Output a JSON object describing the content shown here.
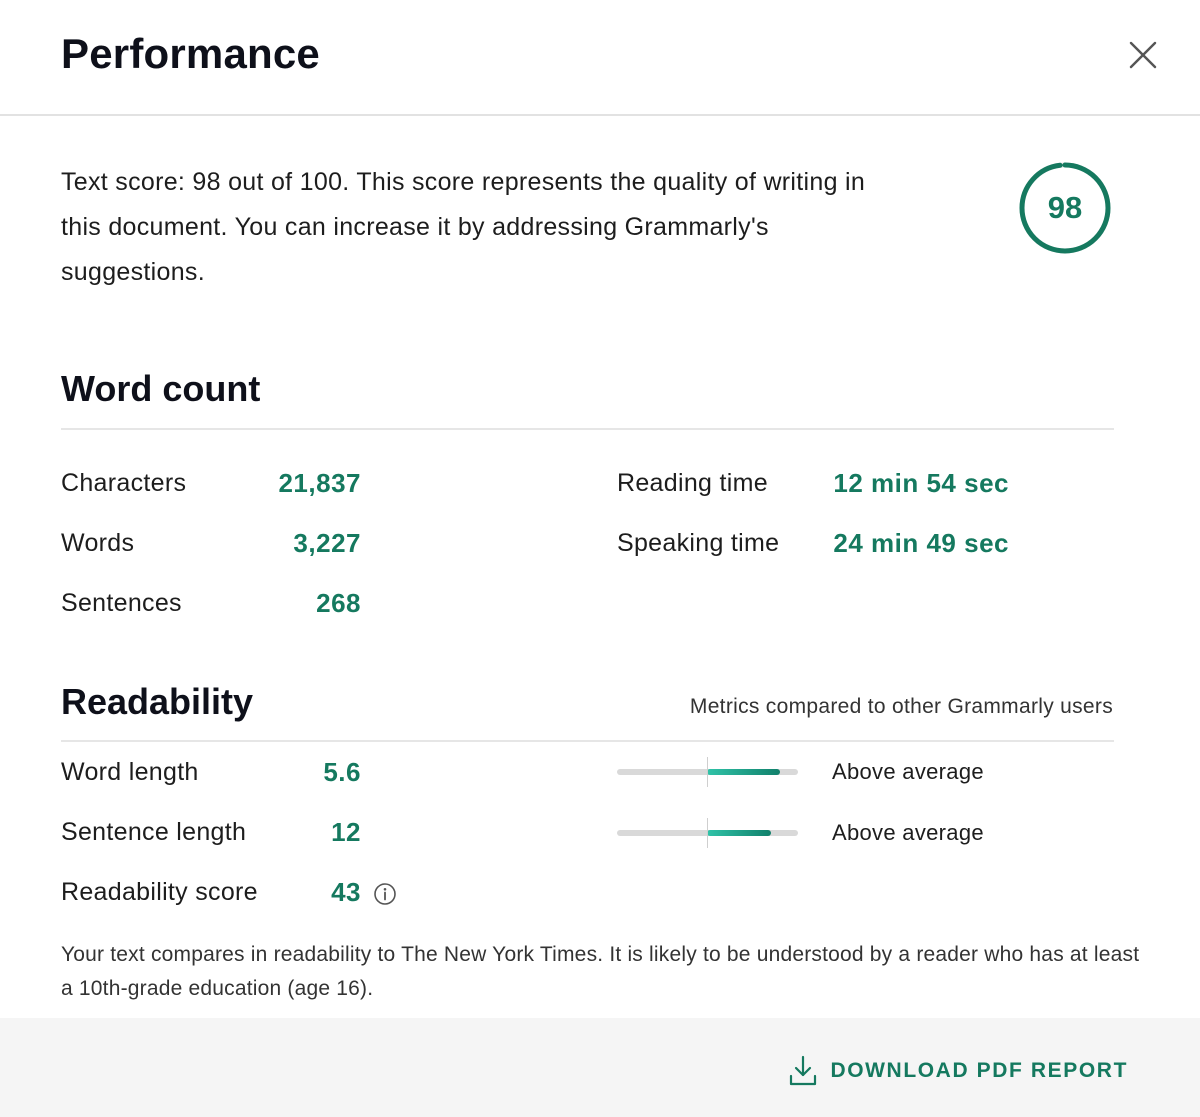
{
  "dialog": {
    "title": "Performance",
    "close_icon": "close-icon"
  },
  "score": {
    "description": "Text score: 98 out of 100. This score represents the quality of writing in this document. You can increase it by addressing Grammarly's suggestions.",
    "value": "98",
    "fraction": 0.98,
    "accent_color": "#15795f"
  },
  "word_count": {
    "title": "Word count",
    "left": [
      {
        "label": "Characters",
        "value": "21,837"
      },
      {
        "label": "Words",
        "value": "3,227"
      },
      {
        "label": "Sentences",
        "value": "268"
      }
    ],
    "right": [
      {
        "label": "Reading time",
        "value": "12 min 54 sec"
      },
      {
        "label": "Speaking time",
        "value": "24 min 49 sec"
      }
    ]
  },
  "readability": {
    "title": "Readability",
    "note": "Metrics compared to other Grammarly users",
    "metrics": [
      {
        "label": "Word length",
        "value": "5.6",
        "comparison": "Above average",
        "bar_fraction": 0.9
      },
      {
        "label": "Sentence length",
        "value": "12",
        "comparison": "Above average",
        "bar_fraction": 0.85
      },
      {
        "label": "Readability score",
        "value": "43",
        "icon": "info-icon"
      }
    ],
    "description": "Your text compares in readability to The New York Times. It is likely to be understood by a reader who has at least a 10th-grade education (age 16)."
  },
  "footer": {
    "download_label": "DOWNLOAD PDF REPORT",
    "download_icon": "download-icon"
  }
}
